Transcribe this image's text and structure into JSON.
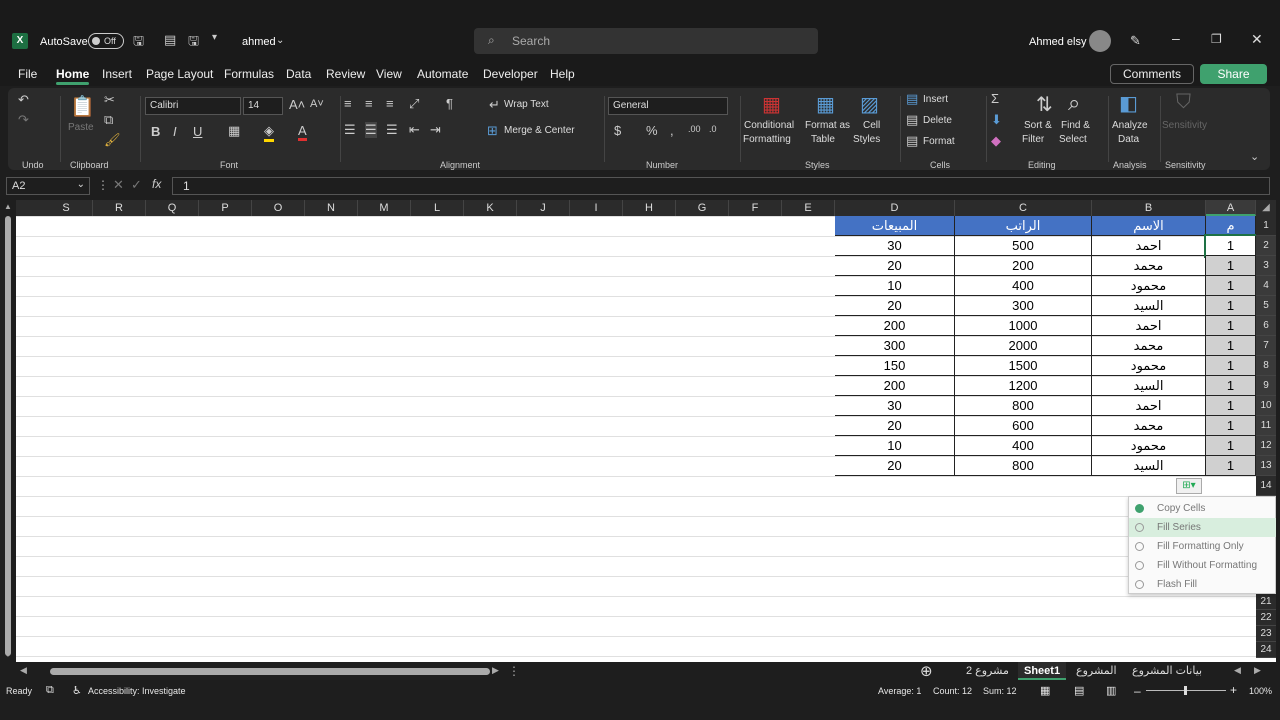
{
  "window": {
    "autosave_label": "AutoSave",
    "autosave_state": "Off",
    "file_name": "ahmed",
    "search_placeholder": "Search",
    "user": "Ahmed elsy"
  },
  "menu": [
    "File",
    "Home",
    "Insert",
    "Page Layout",
    "Formulas",
    "Data",
    "Review",
    "View",
    "Automate",
    "Developer",
    "Help"
  ],
  "actions": {
    "comments": "Comments",
    "share": "Share"
  },
  "ribbon": {
    "undo": "Undo",
    "clipboard": "Clipboard",
    "paste": "Paste",
    "font_group": "Font",
    "font_name": "Calibri",
    "font_size": "14",
    "alignment": "Alignment",
    "wrap_text": "Wrap Text",
    "merge_center": "Merge & Center",
    "number": "Number",
    "number_format": "General",
    "cond_fmt": "Conditional",
    "cond_fmt2": "Formatting",
    "fmt_table": "Format as",
    "fmt_table2": "Table",
    "cell_styles": "Cell",
    "cell_styles2": "Styles",
    "styles": "Styles",
    "insert": "Insert",
    "delete": "Delete",
    "format": "Format",
    "cells": "Cells",
    "sort": "Sort &",
    "sort2": "Filter",
    "find": "Find &",
    "find2": "Select",
    "editing": "Editing",
    "analyze": "Analyze",
    "analyze2": "Data",
    "analysis": "Analysis",
    "sensitivity": "Sensitivity"
  },
  "formula": {
    "name_box": "A2",
    "value": "1",
    "fx": "fx"
  },
  "columns": [
    "S",
    "R",
    "Q",
    "P",
    "O",
    "N",
    "M",
    "L",
    "K",
    "J",
    "I",
    "H",
    "G",
    "F",
    "E",
    "D",
    "C",
    "B",
    "A"
  ],
  "table": {
    "headers": {
      "d": "المبيعات",
      "c": "الراتب",
      "b": "الاسم",
      "a": "م"
    },
    "rows": [
      {
        "a": "1",
        "b": "احمد",
        "c": "500",
        "d": "30"
      },
      {
        "a": "1",
        "b": "محمد",
        "c": "200",
        "d": "20"
      },
      {
        "a": "1",
        "b": "محمود",
        "c": "400",
        "d": "10"
      },
      {
        "a": "1",
        "b": "السيد",
        "c": "300",
        "d": "20"
      },
      {
        "a": "1",
        "b": "احمد",
        "c": "1000",
        "d": "200"
      },
      {
        "a": "1",
        "b": "محمد",
        "c": "2000",
        "d": "300"
      },
      {
        "a": "1",
        "b": "محمود",
        "c": "1500",
        "d": "150"
      },
      {
        "a": "1",
        "b": "السيد",
        "c": "1200",
        "d": "200"
      },
      {
        "a": "1",
        "b": "احمد",
        "c": "800",
        "d": "30"
      },
      {
        "a": "1",
        "b": "محمد",
        "c": "600",
        "d": "20"
      },
      {
        "a": "1",
        "b": "محمود",
        "c": "400",
        "d": "10"
      },
      {
        "a": "1",
        "b": "السيد",
        "c": "800",
        "d": "20"
      }
    ]
  },
  "row_numbers": [
    "1",
    "2",
    "3",
    "4",
    "5",
    "6",
    "7",
    "8",
    "9",
    "10",
    "11",
    "12",
    "13",
    "14",
    "21",
    "22",
    "23",
    "24"
  ],
  "context_menu": [
    "Copy Cells",
    "Fill Series",
    "Fill Formatting Only",
    "Fill Without Formatting",
    "Flash Fill"
  ],
  "sheets": [
    "مشروع 2",
    "Sheet1",
    "المشروع",
    "بيانات المشروع"
  ],
  "status": {
    "ready": "Ready",
    "accessibility": "Accessibility: Investigate",
    "average": "Average: 1",
    "count": "Count: 12",
    "sum": "Sum: 12",
    "zoom": "100%"
  },
  "colors": {
    "header_blue": "#4472c4",
    "accent_green": "#3fa16e",
    "selection_gray": "#d0d0d0"
  }
}
